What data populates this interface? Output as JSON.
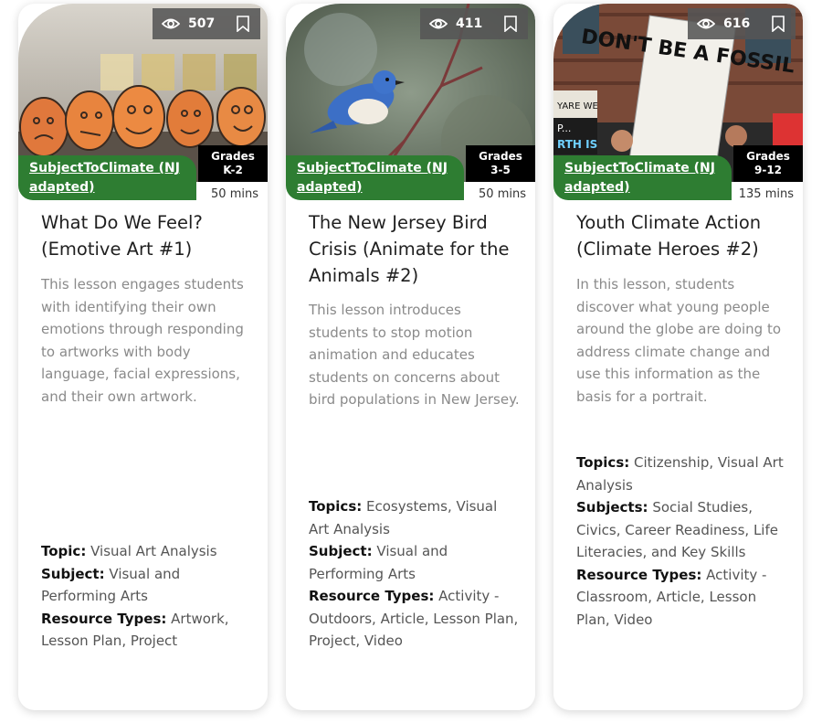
{
  "cards": [
    {
      "views": "507",
      "source": "SubjectToClimate (NJ adapted)",
      "grades_label": "Grades",
      "grades": "K-2",
      "duration": "50 mins",
      "title": "What Do We Feel? (Emotive Art #1)",
      "description": "This lesson engages students with identifying their own emotions through responding to artworks with body language, facial expressions, and their own artwork.",
      "topic_key": "Topic:",
      "topic": "Visual Art Analysis",
      "subject_key": "Subject:",
      "subject": "Visual and Performing Arts",
      "types_key": "Resource Types:",
      "types": "Artwork, Lesson Plan, Project",
      "image_icon": "eggs-with-faces-image"
    },
    {
      "views": "411",
      "source": "SubjectToClimate (NJ adapted)",
      "grades_label": "Grades",
      "grades": "3-5",
      "duration": "50 mins",
      "title": "The New Jersey Bird Crisis (Animate for the Animals #2)",
      "description": "This lesson introduces students to stop motion animation and educates students on concerns about bird populations in New Jersey.",
      "topic_key": "Topics:",
      "topic": "Ecosystems, Visual Art Analysis",
      "subject_key": "Subject:",
      "subject": "Visual and Performing Arts",
      "types_key": "Resource Types:",
      "types": "Activity - Outdoors, Article, Lesson Plan, Project, Video",
      "image_icon": "bluebird-on-branch-image"
    },
    {
      "views": "616",
      "source": "SubjectToClimate (NJ adapted)",
      "grades_label": "Grades",
      "grades": "9-12",
      "duration": "135 mins",
      "title": "Youth Climate Action (Climate Heroes #2)",
      "description": "In this lesson, students discover what young people around the globe are doing to address climate change and use this information as the basis for a portrait.",
      "topic_key": "Topics:",
      "topic": "Citizenship, Visual Art Analysis",
      "subject_key": "Subjects:",
      "subject": "Social Studies, Civics, Career Readiness, Life Literacies, and Key Skills",
      "types_key": "Resource Types:",
      "types": "Activity - Classroom, Article, Lesson Plan, Video",
      "image_icon": "climate-protest-signs-image",
      "sign_texts": [
        "DON'T BE A FOSSIL",
        "YARE WE",
        "P...",
        "RTH IS"
      ]
    }
  ],
  "colors": {
    "source_badge": "#2e7d32",
    "grade_badge": "#000000",
    "stats_bar": "#555555"
  }
}
